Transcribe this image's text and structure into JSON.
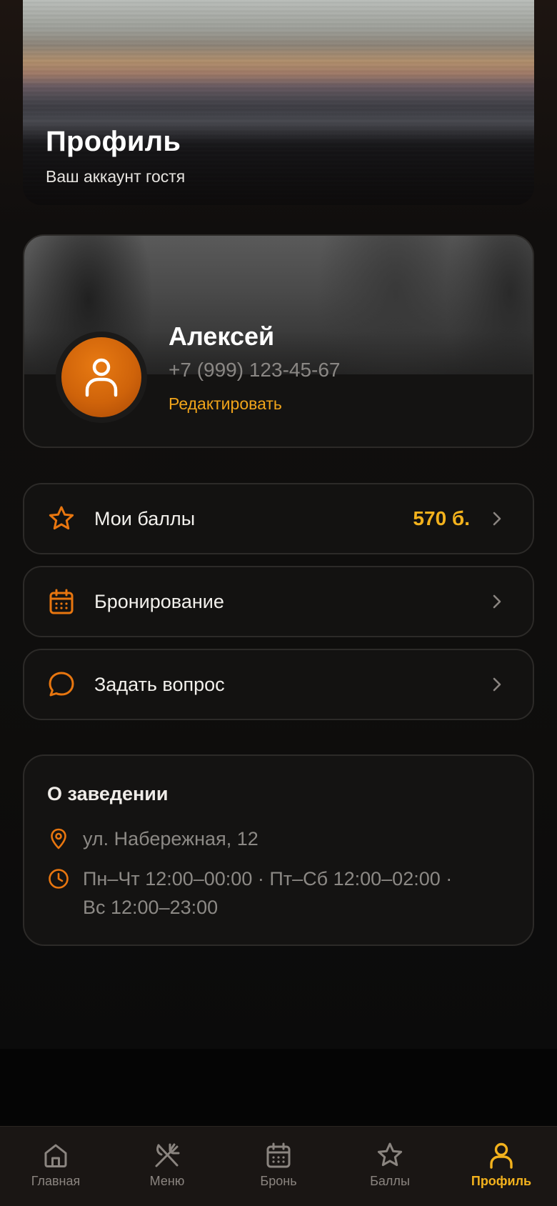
{
  "header": {
    "title": "Профиль",
    "subtitle": "Ваш аккаунт гостя"
  },
  "profile": {
    "name": "Алексей",
    "phone": "+7 (999) 123-45-67",
    "edit_label": "Редактировать"
  },
  "menu": [
    {
      "label": "Мои баллы",
      "value": "570 б.",
      "icon": "star-icon"
    },
    {
      "label": "Бронирование",
      "value": "",
      "icon": "calendar-icon"
    },
    {
      "label": "Задать вопрос",
      "value": "",
      "icon": "chat-icon"
    }
  ],
  "about": {
    "title": "О заведении",
    "address": "ул. Набережная, 12",
    "hours_line1": "Пн–Чт 12:00–00:00 · Пт–Сб 12:00–02:00 ·",
    "hours_line2": "Вс 12:00–23:00"
  },
  "nav": {
    "items": [
      {
        "label": "Главная",
        "icon": "home-icon",
        "active": false
      },
      {
        "label": "Меню",
        "icon": "cutlery-icon",
        "active": false
      },
      {
        "label": "Бронь",
        "icon": "calendar-icon",
        "active": false
      },
      {
        "label": "Баллы",
        "icon": "star-icon",
        "active": false
      },
      {
        "label": "Профиль",
        "icon": "user-icon",
        "active": true
      }
    ]
  },
  "colors": {
    "accent": "#f0a41a",
    "accent_icon": "#e8760f",
    "background": "#0f0e0d",
    "card": "#141312"
  }
}
